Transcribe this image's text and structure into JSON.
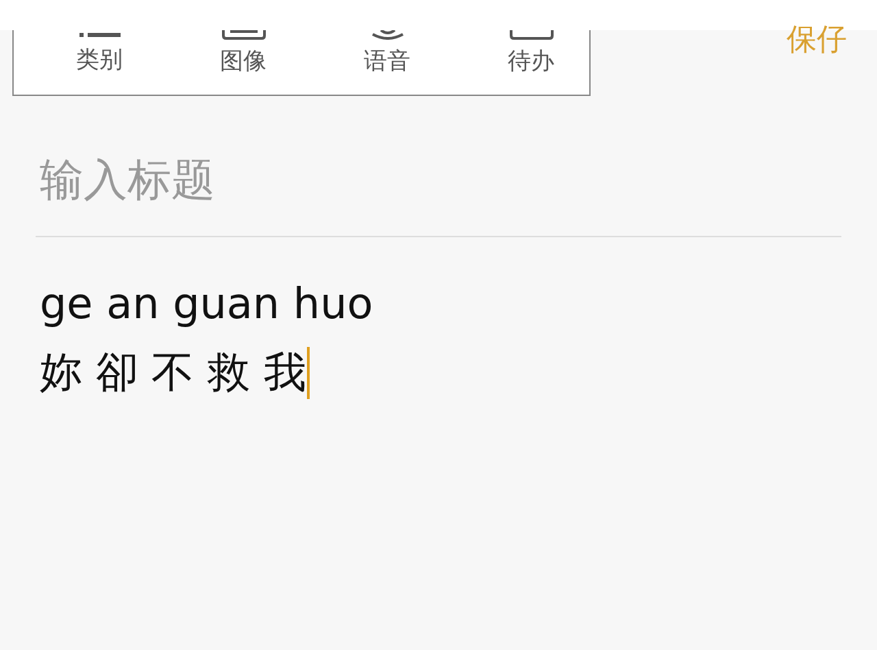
{
  "toolbar": {
    "items": [
      {
        "label": "类别",
        "kind": "category"
      },
      {
        "label": "图像",
        "kind": "image"
      },
      {
        "label": "语音",
        "kind": "voice"
      },
      {
        "label": "待办",
        "kind": "todo"
      }
    ]
  },
  "save_button": {
    "label": "保仔"
  },
  "title_field": {
    "placeholder": "输入标题"
  },
  "body": {
    "lines": [
      "ge an guan huo",
      "妳 卻 不 救 我"
    ],
    "cursor": true
  }
}
